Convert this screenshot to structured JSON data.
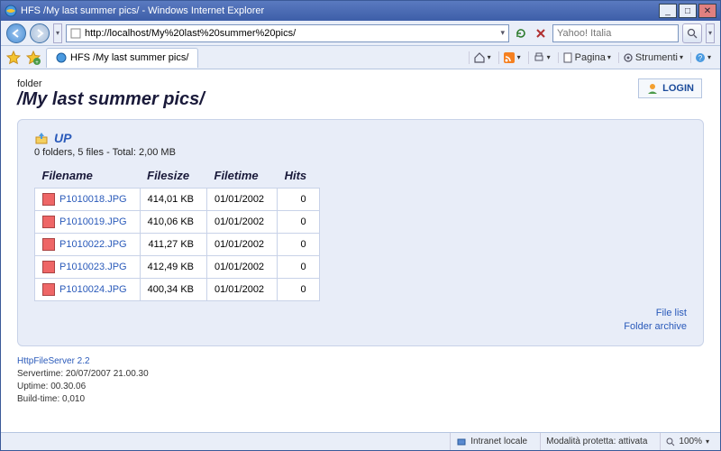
{
  "window": {
    "title": "HFS /My last summer pics/ - Windows Internet Explorer"
  },
  "nav": {
    "url": "http://localhost/My%20last%20summer%20pics/",
    "search_placeholder": "Yahoo! Italia"
  },
  "tab": {
    "label": "HFS /My last summer pics/"
  },
  "toolbar": {
    "page_label": "Pagina",
    "tools_label": "Strumenti"
  },
  "page": {
    "folder_label": "folder",
    "folder_title": "/My last summer pics/",
    "login_label": "LOGIN",
    "up_label": "UP",
    "stats": "0 folders, 5 files - Total: 2,00 MB",
    "columns": {
      "name": "Filename",
      "size": "Filesize",
      "time": "Filetime",
      "hits": "Hits"
    },
    "files": [
      {
        "name": "P1010018.JPG",
        "size": "414,01 KB",
        "time": "01/01/2002",
        "hits": "0"
      },
      {
        "name": "P1010019.JPG",
        "size": "410,06 KB",
        "time": "01/01/2002",
        "hits": "0"
      },
      {
        "name": "P1010022.JPG",
        "size": "411,27 KB",
        "time": "01/01/2002",
        "hits": "0"
      },
      {
        "name": "P1010023.JPG",
        "size": "412,49 KB",
        "time": "01/01/2002",
        "hits": "0"
      },
      {
        "name": "P1010024.JPG",
        "size": "400,34 KB",
        "time": "01/01/2002",
        "hits": "0"
      }
    ],
    "links": {
      "file_list": "File list",
      "folder_archive": "Folder archive"
    },
    "footer": {
      "app": "HttpFileServer 2.2",
      "servertime": "Servertime: 20/07/2007 21.00.30",
      "uptime": "Uptime: 00.30.06",
      "buildtime": "Build-time: 0,010"
    }
  },
  "status": {
    "zone": "Intranet locale",
    "protected": "Modalità protetta: attivata",
    "zoom": "100%"
  }
}
